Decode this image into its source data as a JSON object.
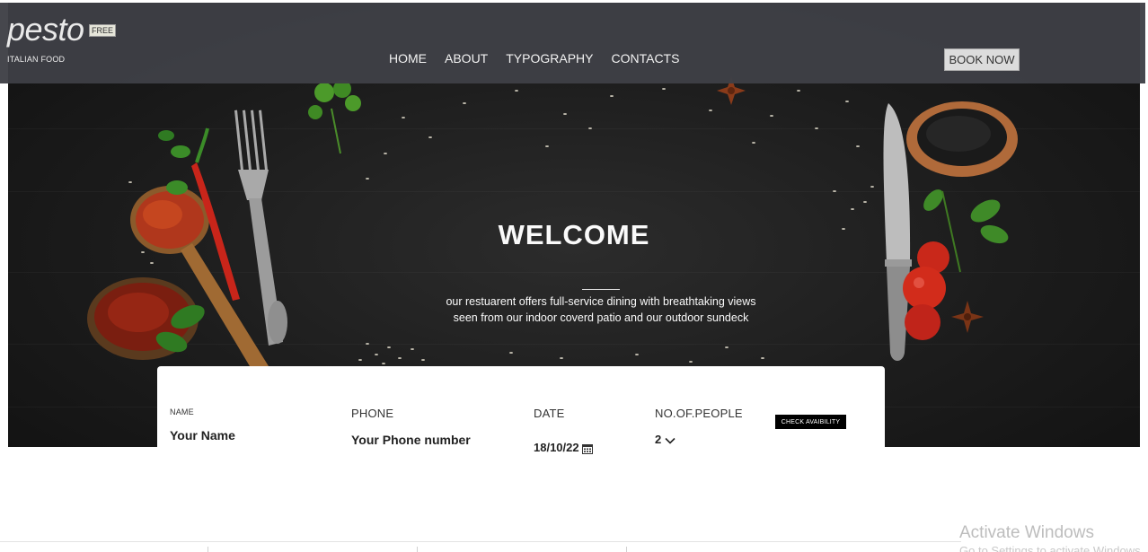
{
  "header": {
    "logo": "pesto",
    "badge": "FREE",
    "tagline": "ITALIAN FOOD",
    "nav": [
      "HOME",
      "ABOUT",
      "TYPOGRAPHY",
      "CONTACTS"
    ],
    "book_label": "BOOK NOW"
  },
  "hero": {
    "title": "WELCOME",
    "line1": "our restuarent offers full-service dining with breathtaking views",
    "line2": "seen from our indoor coverd patio and our outdoor sundeck"
  },
  "booking": {
    "name_label": "NAME",
    "name_value": "Your Name",
    "phone_label": "PHONE",
    "phone_value": "Your Phone number",
    "date_label": "DATE",
    "date_value": "18/10/22",
    "people_label": "NO.OF.PEOPLE",
    "people_value": "2",
    "check_label": "CHECK AVAIBILITY"
  },
  "watermark": {
    "line1": "Activate Windows",
    "line2": "Go to Settings to activate Windows."
  },
  "colors": {
    "header_bg": "#3e4046",
    "hero_bg": "#1c1c1c",
    "button_dark": "#000000"
  }
}
